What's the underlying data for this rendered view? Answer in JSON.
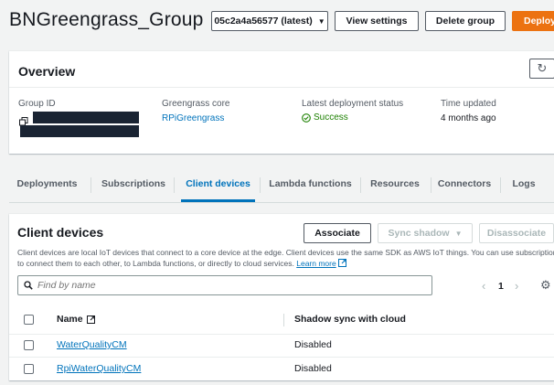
{
  "header": {
    "title": "BNGreengrass_Group",
    "version_select": "05c2a4a56577 (latest)",
    "view_settings_label": "View settings",
    "delete_group_label": "Delete group",
    "deploy_label": "Deploy"
  },
  "overview": {
    "title": "Overview",
    "group_id_label": "Group ID",
    "core_label": "Greengrass core",
    "core_value": "RPiGreengrass",
    "status_label": "Latest deployment status",
    "status_value": "Success",
    "time_label": "Time updated",
    "time_value": "4 months ago"
  },
  "tabs": [
    {
      "label": "Deployments"
    },
    {
      "label": "Subscriptions"
    },
    {
      "label": "Client devices"
    },
    {
      "label": "Lambda functions"
    },
    {
      "label": "Resources"
    },
    {
      "label": "Connectors"
    },
    {
      "label": "Logs"
    }
  ],
  "active_tab": "Client devices",
  "client_devices": {
    "title": "Client devices",
    "associate_label": "Associate",
    "sync_shadow_label": "Sync shadow",
    "disassociate_label": "Disassociate",
    "description_1": "Client devices are local IoT devices that connect to a core device at the edge. Client devices use the same SDK as AWS IoT things. You can use subscriptions",
    "description_2": "to connect them to each other, to Lambda functions, or directly to cloud services.",
    "learn_more": "Learn more",
    "search_placeholder": "Find by name",
    "page_number": "1",
    "columns": {
      "name": "Name",
      "shadow": "Shadow sync with cloud"
    },
    "rows": [
      {
        "name": "WaterQualityCM",
        "shadow": "Disabled"
      },
      {
        "name": "RpiWaterQualityCM",
        "shadow": "Disabled"
      }
    ]
  },
  "colors": {
    "accent": "#0073bb",
    "primary_button": "#ec7211",
    "success": "#1d8102",
    "background": "#f2f3f3"
  }
}
